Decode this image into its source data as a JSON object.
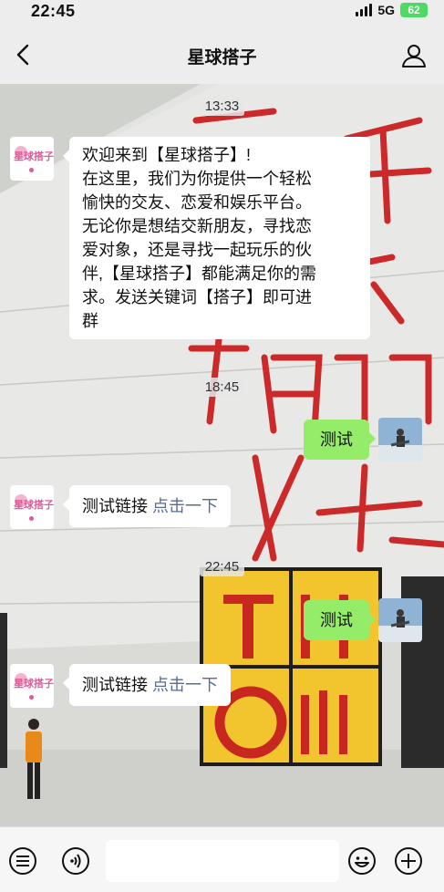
{
  "status": {
    "time": "22:45",
    "network": "5G",
    "battery": "62"
  },
  "nav": {
    "title": "星球搭子",
    "back_icon": "chevron-left-icon",
    "profile_icon": "user-icon"
  },
  "brand_avatar_text": "星球搭子",
  "messages": [
    {
      "type": "time",
      "text": "13:33"
    },
    {
      "type": "text",
      "side": "left",
      "lines": [
        "欢迎来到【星球搭子】!",
        "在这里，我们为你提供一个轻松",
        "愉快的交友、恋爱和娱乐平台。",
        "无论你是想结交新朋友，寻找恋",
        "爱对象，还是寻找一起玩乐的伙",
        "伴,【星球搭子】都能满足你的需",
        "求。发送关键词【搭子】即可进",
        "群"
      ]
    },
    {
      "type": "time",
      "text": "18:45"
    },
    {
      "type": "text",
      "side": "right",
      "text": "测试"
    },
    {
      "type": "link",
      "side": "left",
      "text": "测试链接",
      "link": "点击一下"
    },
    {
      "type": "time",
      "text": "22:45"
    },
    {
      "type": "text",
      "side": "right",
      "text": "测试"
    },
    {
      "type": "link",
      "side": "left",
      "text": "测试链接",
      "link": "点击一下"
    }
  ],
  "bottom_bar": {
    "icons": [
      "menu-icon",
      "voice-icon",
      "emoji-icon",
      "plus-icon"
    ],
    "input_value": ""
  },
  "colors": {
    "outgoing_bubble": "#95ec69",
    "link": "#576b95",
    "battery": "#4cd964"
  }
}
